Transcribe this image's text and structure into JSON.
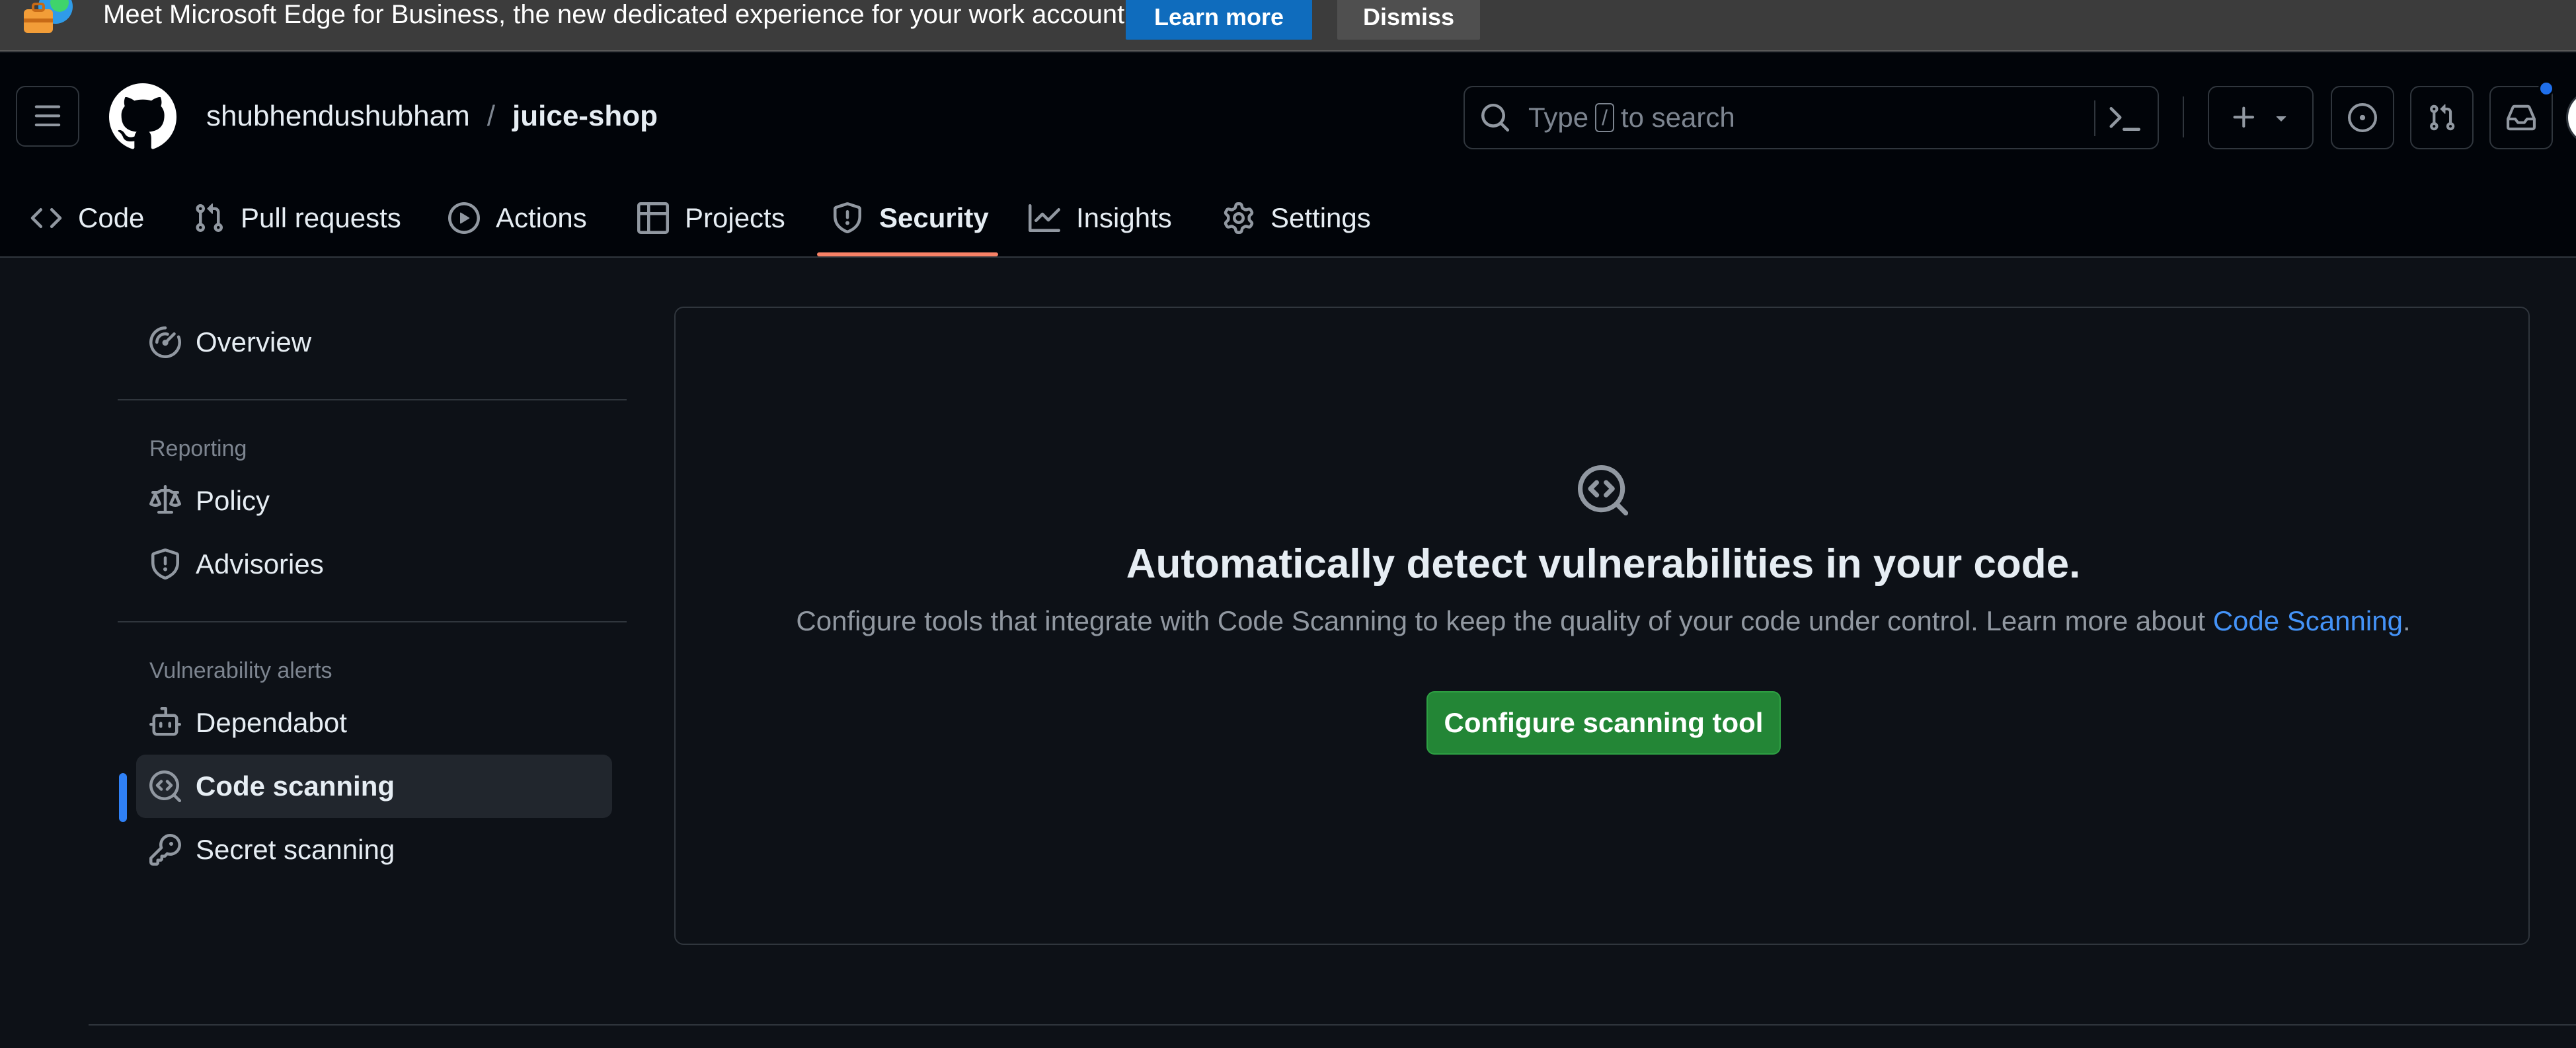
{
  "banner": {
    "message": "Meet Microsoft Edge for Business, the new dedicated experience for your work account.",
    "learn_more": "Learn more",
    "dismiss": "Dismiss"
  },
  "header": {
    "owner": "shubhendushubham",
    "separator": "/",
    "repo": "juice-shop",
    "search": {
      "prefix": "Type",
      "key": "/",
      "suffix": "to search"
    },
    "notification_color": "#1f6feb"
  },
  "tabs": [
    {
      "label": "Code",
      "icon": "code-icon"
    },
    {
      "label": "Pull requests",
      "icon": "git-pull-request-icon"
    },
    {
      "label": "Actions",
      "icon": "play-icon"
    },
    {
      "label": "Projects",
      "icon": "table-icon"
    },
    {
      "label": "Security",
      "icon": "shield-icon",
      "active": true
    },
    {
      "label": "Insights",
      "icon": "graph-icon"
    },
    {
      "label": "Settings",
      "icon": "gear-icon"
    }
  ],
  "sidebar": {
    "overview": "Overview",
    "reporting_heading": "Reporting",
    "policy": "Policy",
    "advisories": "Advisories",
    "vuln_heading": "Vulnerability alerts",
    "dependabot": "Dependabot",
    "code_scanning": "Code scanning",
    "secret_scanning": "Secret scanning",
    "selected": "Code scanning"
  },
  "main": {
    "title": "Automatically detect vulnerabilities in your code.",
    "description": "Configure tools that integrate with Code Scanning to keep the quality of your code under control. Learn more about ",
    "link": "Code Scanning",
    "period": ".",
    "button": "Configure scanning tool"
  },
  "colors": {
    "accent_tab": "#f78166",
    "primary_button": "#238636",
    "link": "#4493f8",
    "selected_indicator": "#2f81f7"
  }
}
